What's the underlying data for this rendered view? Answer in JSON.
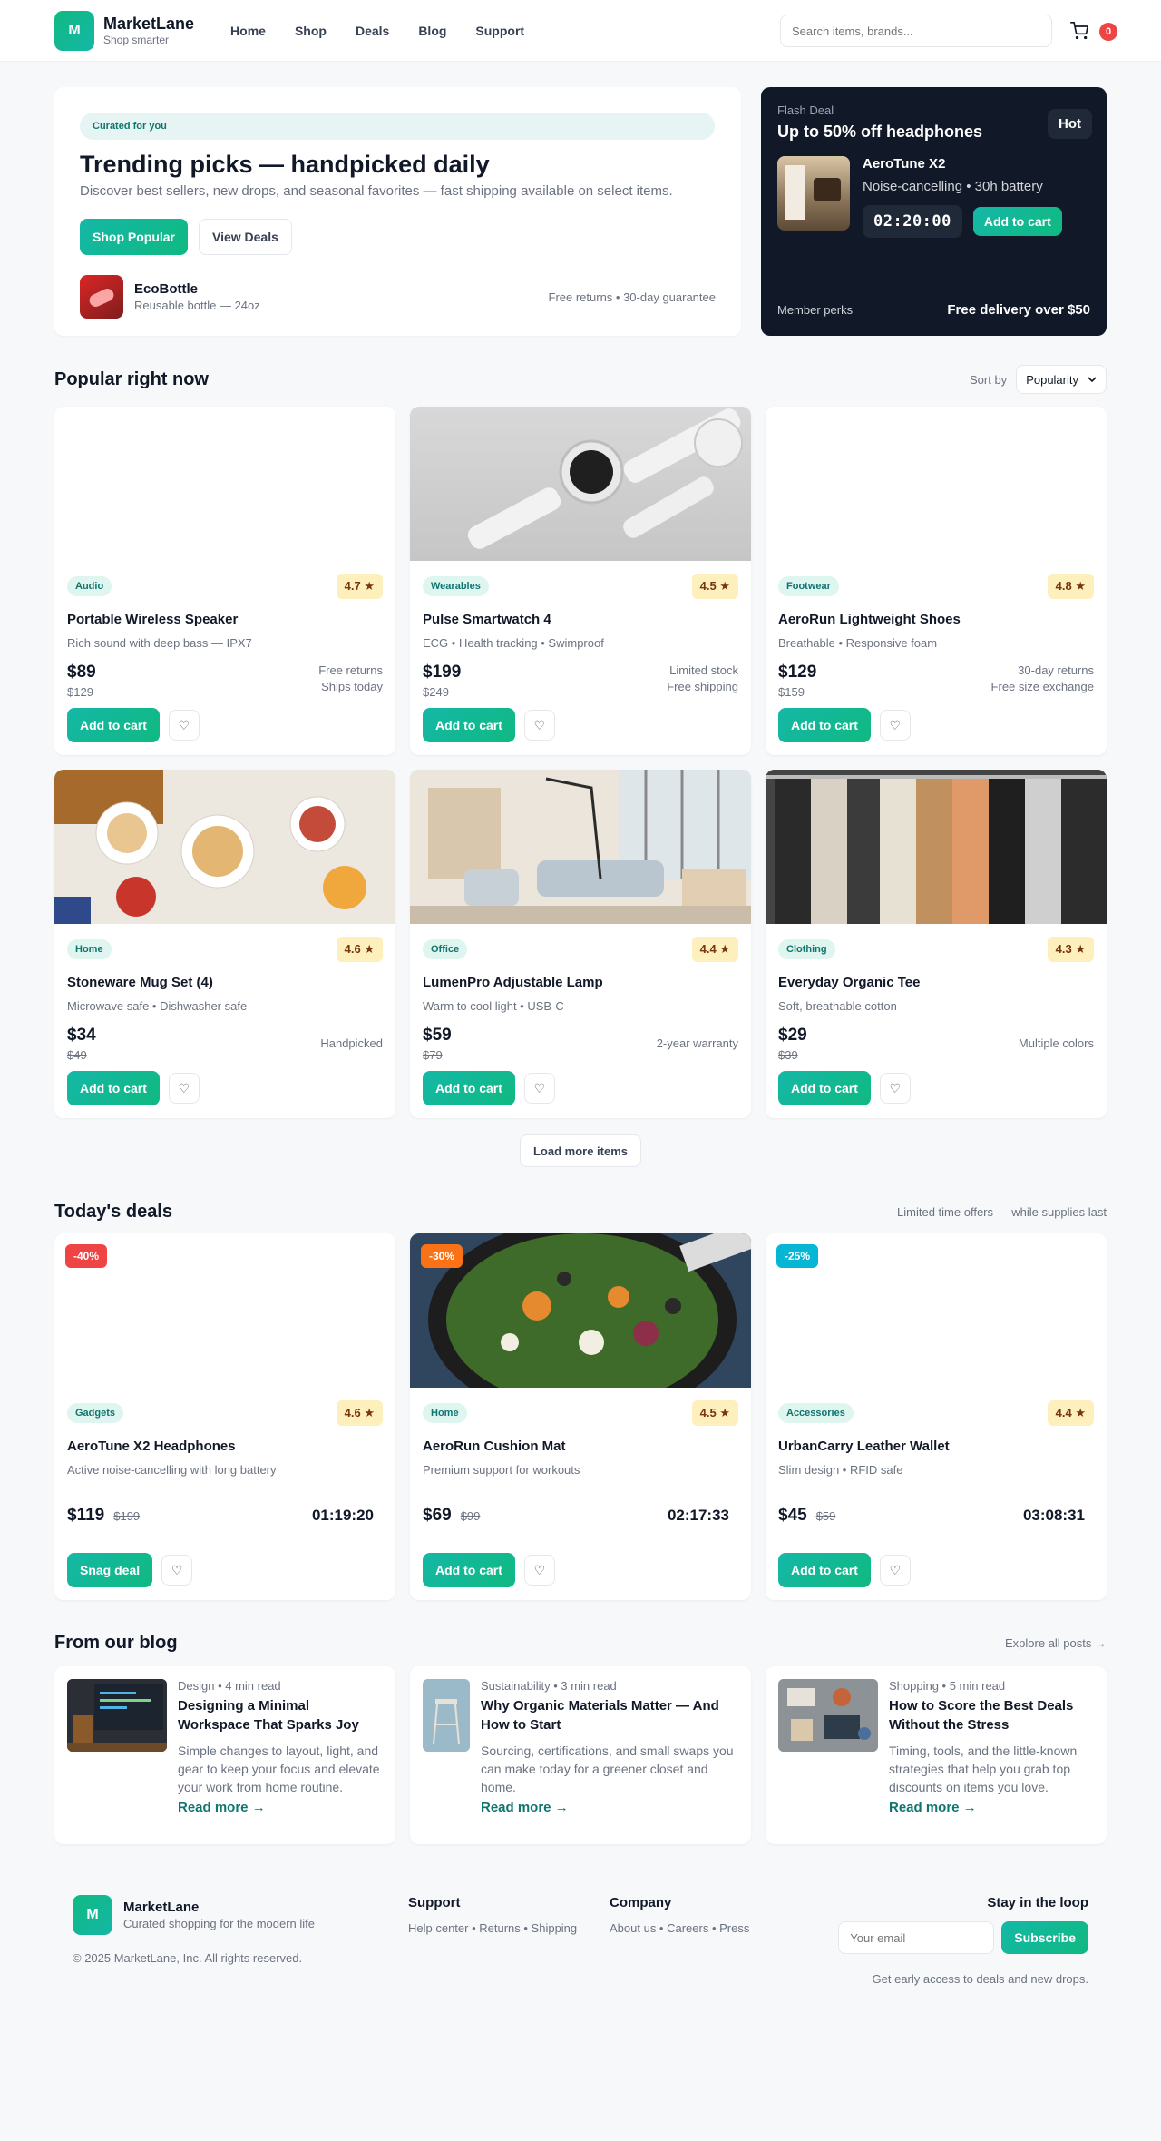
{
  "header": {
    "logo_letter": "M",
    "brand": "MarketLane",
    "tagline": "Shop smarter",
    "nav": [
      "Home",
      "Shop",
      "Deals",
      "Blog",
      "Support"
    ],
    "search_placeholder": "Search items, brands...",
    "cart_count": "0"
  },
  "hero": {
    "pill": "Curated for you",
    "title": "Trending picks — handpicked daily",
    "subtitle": "Discover best sellers, new drops, and seasonal favorites — fast shipping available on select items.",
    "primary_btn": "Shop Popular",
    "secondary_btn": "View Deals",
    "featured_name": "EcoBottle",
    "featured_desc": "Reusable bottle — 24oz",
    "guarantee": "Free returns • 30-day guarantee"
  },
  "flash": {
    "label": "Flash Deal",
    "title": "Up to 50% off headphones",
    "badge": "Hot",
    "product": "AeroTune X2",
    "desc": "Noise-cancelling • 30h battery",
    "timer": "02:20:00",
    "button": "Add to cart",
    "perks": "Member perks",
    "delivery": "Free delivery over $50"
  },
  "popular": {
    "title": "Popular right now",
    "sort_label": "Sort by",
    "sort_value": "Popularity",
    "add_label": "Add to cart",
    "load_more": "Load more items",
    "items": [
      {
        "cat": "Audio",
        "rating": "4.7 ★",
        "name": "Portable Wireless Speaker",
        "desc": "Rich sound with deep bass — IPX7",
        "price": "$89",
        "old": "$129",
        "meta1": "Free returns",
        "meta2": "Ships today"
      },
      {
        "cat": "Wearables",
        "rating": "4.5 ★",
        "name": "Pulse Smartwatch 4",
        "desc": "ECG • Health tracking • Swimproof",
        "price": "$199",
        "old": "$249",
        "meta1": "Limited stock",
        "meta2": "Free shipping"
      },
      {
        "cat": "Footwear",
        "rating": "4.8 ★",
        "name": "AeroRun Lightweight Shoes",
        "desc": "Breathable • Responsive foam",
        "price": "$129",
        "old": "$159",
        "meta1": "30-day returns",
        "meta2": "Free size exchange"
      },
      {
        "cat": "Home",
        "rating": "4.6 ★",
        "name": "Stoneware Mug Set (4)",
        "desc": "Microwave safe • Dishwasher safe",
        "price": "$34",
        "old": "$49",
        "meta1": "Handpicked",
        "meta2": ""
      },
      {
        "cat": "Office",
        "rating": "4.4 ★",
        "name": "LumenPro Adjustable Lamp",
        "desc": "Warm to cool light • USB-C",
        "price": "$59",
        "old": "$79",
        "meta1": "2-year warranty",
        "meta2": ""
      },
      {
        "cat": "Clothing",
        "rating": "4.3 ★",
        "name": "Everyday Organic Tee",
        "desc": "Soft, breathable cotton",
        "price": "$29",
        "old": "$39",
        "meta1": "Multiple colors",
        "meta2": ""
      }
    ]
  },
  "deals": {
    "title": "Today's deals",
    "note": "Limited time offers — while supplies last",
    "items": [
      {
        "discount": "-40%",
        "disc_color": "#ef4444",
        "cat": "Gadgets",
        "rating": "4.6 ★",
        "name": "AeroTune X2 Headphones",
        "desc": "Active noise-cancelling with long battery",
        "price": "$119",
        "old": "$199",
        "countdown": "01:19:20",
        "button": "Snag deal"
      },
      {
        "discount": "-30%",
        "disc_color": "#f97316",
        "cat": "Home",
        "rating": "4.5 ★",
        "name": "AeroRun Cushion Mat",
        "desc": "Premium support for workouts",
        "price": "$69",
        "old": "$99",
        "countdown": "02:17:33",
        "button": "Add to cart"
      },
      {
        "discount": "-25%",
        "disc_color": "#06b6d4",
        "cat": "Accessories",
        "rating": "4.4 ★",
        "name": "UrbanCarry Leather Wallet",
        "desc": "Slim design • RFID safe",
        "price": "$45",
        "old": "$59",
        "countdown": "03:08:31",
        "button": "Add to cart"
      }
    ]
  },
  "blog": {
    "title": "From our blog",
    "explore": "Explore all posts →",
    "read_more": "Read more →",
    "posts": [
      {
        "meta": "Design • 4 min read",
        "title": "Designing a Minimal Workspace That Sparks Joy",
        "excerpt": "Simple changes to layout, light, and gear to keep your focus and elevate your work from home routine."
      },
      {
        "meta": "Sustainability • 3 min read",
        "title": "Why Organic Materials Matter — And How to Start",
        "excerpt": "Sourcing, certifications, and small swaps you can make today for a greener closet and home."
      },
      {
        "meta": "Shopping • 5 min read",
        "title": "How to Score the Best Deals Without the Stress",
        "excerpt": "Timing, tools, and the little-known strategies that help you grab top discounts on items you love."
      }
    ]
  },
  "footer": {
    "brand": "MarketLane",
    "tagline": "Curated shopping for the modern life",
    "copyright": "© 2025 MarketLane, Inc. All rights reserved.",
    "support_title": "Support",
    "support_links": "Help center • Returns • Shipping",
    "company_title": "Company",
    "company_links": "About us • Careers • Press",
    "news_title": "Stay in the loop",
    "email_placeholder": "Your email",
    "subscribe": "Subscribe",
    "news_note": "Get early access to deals and new drops."
  }
}
